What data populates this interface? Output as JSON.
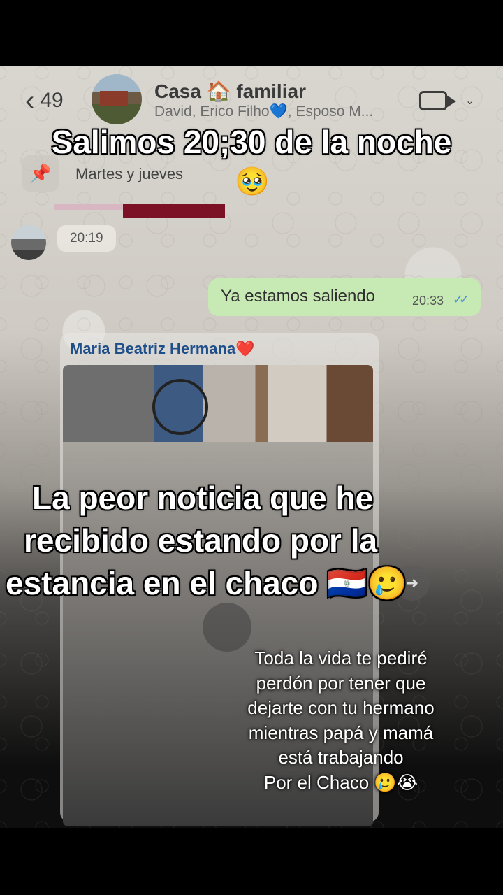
{
  "header": {
    "back_count": "49",
    "group_title": "Casa 🏠 familiar",
    "group_subtitle": "David, Erico Filho💙, Esposo M..."
  },
  "pinned": {
    "text": "Martes y jueves",
    "emoji": "🥹"
  },
  "messages": {
    "incoming_time": "20:19",
    "outgoing_text": "Ya estamos saliendo",
    "outgoing_time": "20:33",
    "outgoing_ticks": "✓✓",
    "media_sender": "Maria Beatriz Hermana❤️"
  },
  "captions": {
    "top": "Salimos 20;30 de la noche",
    "middle": [
      "La peor noticia que he",
      "recibido estando por la",
      "estancia en el chaco 🇵🇾🥲"
    ],
    "bottom": [
      "Toda la vida te pediré",
      "perdón por tener que",
      "dejarte con tu hermano",
      "mientras papá y mamá",
      "está trabajando",
      "Por el Chaco 🥲😭"
    ]
  },
  "icons": {
    "back": "chevron-left-icon",
    "video": "video-camera-icon",
    "pin": "pin-icon",
    "play": "play-icon"
  },
  "colors": {
    "outgoing_bubble": "#c7e9b4",
    "sender_name": "#1f4f8a",
    "read_ticks": "#4a90d9"
  }
}
